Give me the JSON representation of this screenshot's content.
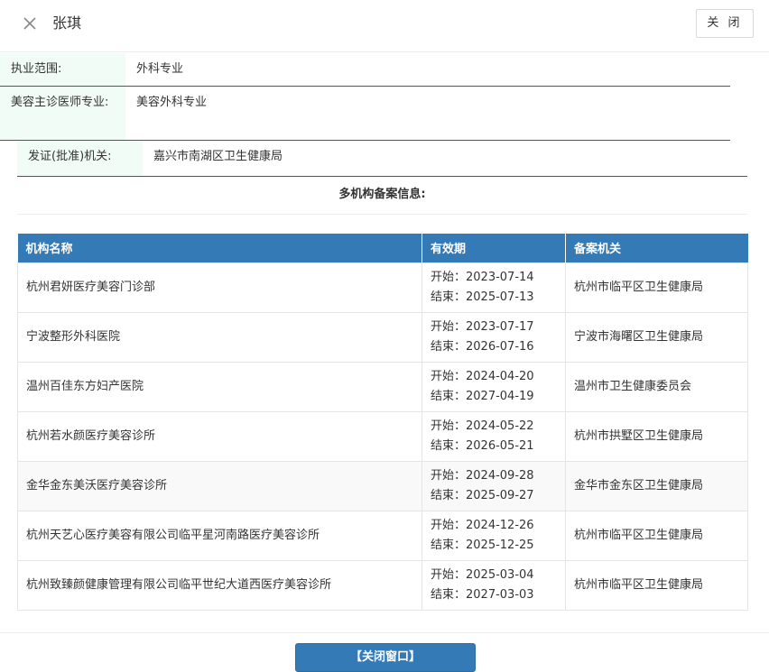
{
  "header": {
    "title": "张琪",
    "close_label": "关 闭"
  },
  "info_rows": [
    {
      "label": "执业范围:",
      "value": "外科专业"
    },
    {
      "label": "美容主诊医师专业:",
      "value": "美容外科专业"
    },
    {
      "label": "发证(批准)机关:",
      "value": "嘉兴市南湖区卫生健康局"
    }
  ],
  "section_title": "多机构备案信息:",
  "table": {
    "headers": [
      "机构名称",
      "有效期",
      "备案机关"
    ],
    "rows": [
      {
        "name": "杭州君妍医疗美容门诊部",
        "start": "开始：2023-07-14",
        "end": "结束：2025-07-13",
        "authority": "杭州市临平区卫生健康局"
      },
      {
        "name": "宁波整形外科医院",
        "start": "开始：2023-07-17",
        "end": "结束：2026-07-16",
        "authority": "宁波市海曙区卫生健康局"
      },
      {
        "name": "温州百佳东方妇产医院",
        "start": "开始：2024-04-20",
        "end": "结束：2027-04-19",
        "authority": "温州市卫生健康委员会"
      },
      {
        "name": "杭州若水颜医疗美容诊所",
        "start": "开始：2024-05-22",
        "end": "结束：2026-05-21",
        "authority": "杭州市拱墅区卫生健康局"
      },
      {
        "name": "金华金东美沃医疗美容诊所",
        "start": "开始：2024-09-28",
        "end": "结束：2025-09-27",
        "authority": "金华市金东区卫生健康局"
      },
      {
        "name": "杭州天艺心医疗美容有限公司临平星河南路医疗美容诊所",
        "start": "开始：2024-12-26",
        "end": "结束：2025-12-25",
        "authority": "杭州市临平区卫生健康局"
      },
      {
        "name": "杭州致臻颜健康管理有限公司临平世纪大道西医疗美容诊所",
        "start": "开始：2025-03-04",
        "end": "结束：2027-03-03",
        "authority": "杭州市临平区卫生健康局"
      }
    ]
  },
  "footer": {
    "close_window_label": "【关闭窗口】"
  },
  "colors": {
    "accent": "#337ab7",
    "label_bg": "#f0fcf5",
    "row_divider": "#2b6d48"
  },
  "icons": {
    "close": "close-x-icon"
  }
}
